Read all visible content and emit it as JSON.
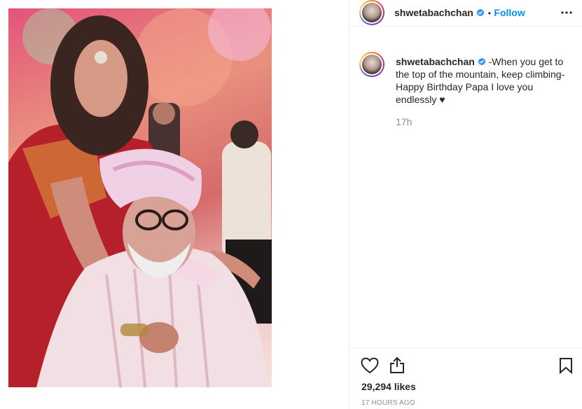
{
  "post": {
    "username": "shwetabachchan",
    "follow_label": "Follow",
    "separator": "•",
    "caption_text": "-When you get to the top of the mountain, keep climbing- Happy Birthday Papa I love you endlessly ♥",
    "comment_time": "17h",
    "likes": "29,294 likes",
    "posted_ago": "17 HOURS AGO"
  },
  "icons": {
    "more": "more-options-icon",
    "like": "heart-icon",
    "share": "share-icon",
    "save": "bookmark-icon",
    "verified": "verified-badge-icon"
  },
  "colors": {
    "accent": "#0095f6",
    "verified": "#3897f0",
    "muted": "#8e8e8e",
    "text": "#262626"
  }
}
